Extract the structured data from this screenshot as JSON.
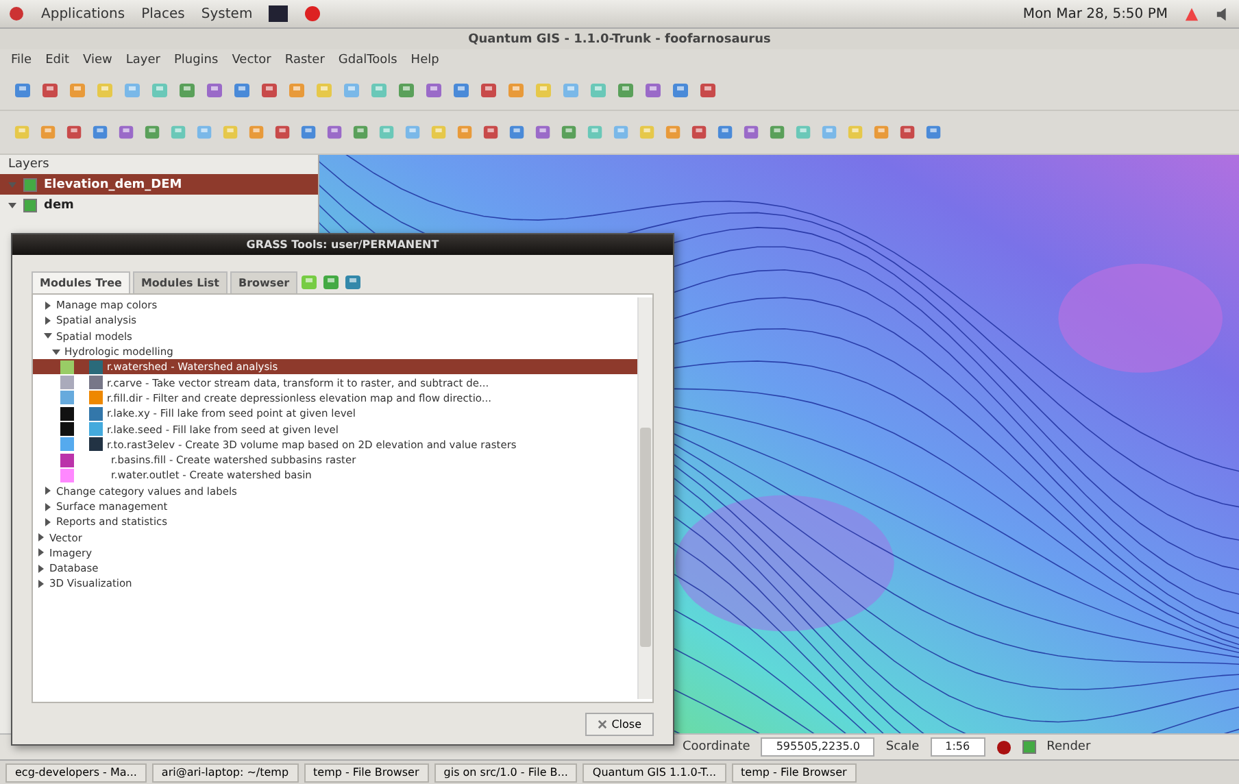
{
  "top_panel": {
    "menus": [
      "Applications",
      "Places",
      "System"
    ],
    "clock": "Mon Mar 28,  5:50 PM"
  },
  "window": {
    "title": "Quantum GIS - 1.1.0-Trunk - foofarnosaurus"
  },
  "menu_bar": [
    "File",
    "Edit",
    "View",
    "Layer",
    "Plugins",
    "Vector",
    "Raster",
    "GdalTools",
    "Help"
  ],
  "layers_panel": {
    "title": "Layers",
    "layers": [
      {
        "name": "Elevation_dem_DEM",
        "selected": true,
        "checked": true,
        "expanded": true
      },
      {
        "name": "dem",
        "selected": false,
        "checked": true,
        "expanded": true
      }
    ]
  },
  "grass_dialog": {
    "title": "GRASS Tools: user/PERMANENT",
    "tabs": [
      {
        "label": "Modules Tree",
        "selected": true
      },
      {
        "label": "Modules List",
        "selected": false
      },
      {
        "label": "Browser",
        "selected": false
      }
    ],
    "tree": [
      {
        "label": "Manage map colors",
        "expanded": false
      },
      {
        "label": "Spatial analysis",
        "expanded": false
      },
      {
        "label": "Spatial models",
        "expanded": true,
        "children": [
          {
            "label": "Hydrologic modelling",
            "expanded": true,
            "children": [
              {
                "label": "r.watershed - Watershed analysis",
                "selected": true
              },
              {
                "label": "r.carve - Take vector stream data, transform it to raster, and subtract de...",
                "selected": false
              },
              {
                "label": "r.fill.dir - Filter and create depressionless elevation map and flow directio...",
                "selected": false
              },
              {
                "label": "r.lake.xy - Fill lake from seed point at given level",
                "selected": false
              },
              {
                "label": "r.lake.seed - Fill lake from seed at given level",
                "selected": false
              },
              {
                "label": "r.to.rast3elev - Create 3D volume map based on 2D elevation and value rasters",
                "selected": false
              },
              {
                "label": "r.basins.fill - Create watershed subbasins raster",
                "selected": false
              },
              {
                "label": "r.water.outlet - Create watershed basin",
                "selected": false
              }
            ]
          }
        ]
      },
      {
        "label": "Change category values and labels",
        "expanded": false
      },
      {
        "label": "Surface management",
        "expanded": false
      },
      {
        "label": "Reports and statistics",
        "expanded": false
      }
    ],
    "top_level": [
      {
        "label": "Vector",
        "expanded": false
      },
      {
        "label": "Imagery",
        "expanded": false
      },
      {
        "label": "Database",
        "expanded": false
      },
      {
        "label": "3D Visualization",
        "expanded": false
      }
    ],
    "close_button": "Close"
  },
  "status_bar": {
    "coordinate_label": "Coordinate",
    "coordinate": "595505,2235.0",
    "scale_label": "Scale",
    "scale": "1:56",
    "render": {
      "label": "Render",
      "checked": true
    }
  },
  "taskbar": [
    "ecg-developers - Ma...",
    "ari@ari-laptop: ~/temp",
    "temp - File Browser",
    "gis on src/1.0 - File B...",
    "Quantum GIS 1.1.0-T...",
    "temp - File Browser"
  ]
}
